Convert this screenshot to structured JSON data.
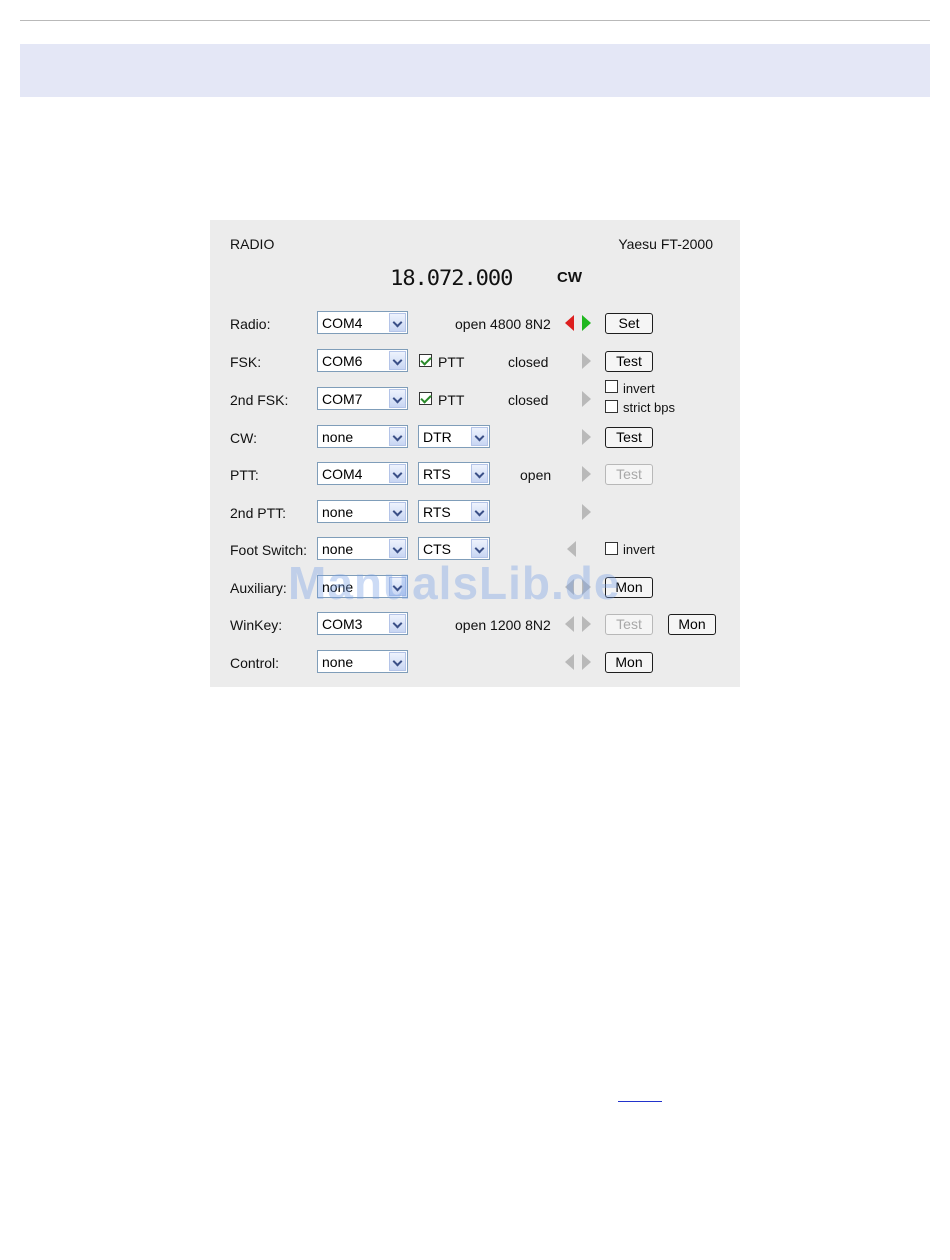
{
  "panel": {
    "title": "RADIO",
    "radio_model": "Yaesu FT-2000",
    "frequency": "18.072.000",
    "mode": "CW"
  },
  "rows": {
    "radio": {
      "label": "Radio:",
      "port": "COM4",
      "status": "open 4800 8N2",
      "button": "Set"
    },
    "fsk": {
      "label": "FSK:",
      "port": "COM6",
      "ptt_label": "PTT",
      "ptt_checked": true,
      "status": "closed",
      "button": "Test"
    },
    "fsk2": {
      "label": "2nd FSK:",
      "port": "COM7",
      "ptt_label": "PTT",
      "ptt_checked": true,
      "status": "closed",
      "invert_label": "invert",
      "strict_label": "strict bps"
    },
    "cw": {
      "label": "CW:",
      "port": "none",
      "line": "DTR",
      "button": "Test"
    },
    "ptt": {
      "label": "PTT:",
      "port": "COM4",
      "line": "RTS",
      "status": "open",
      "button": "Test"
    },
    "ptt2": {
      "label": "2nd PTT:",
      "port": "none",
      "line": "RTS"
    },
    "foot": {
      "label": "Foot Switch:",
      "port": "none",
      "line": "CTS",
      "invert_label": "invert"
    },
    "aux": {
      "label": "Auxiliary:",
      "port": "none",
      "button": "Mon"
    },
    "winkey": {
      "label": "WinKey:",
      "port": "COM3",
      "status": "open 1200 8N2",
      "test_button": "Test",
      "mon_button": "Mon"
    },
    "control": {
      "label": "Control:",
      "port": "none",
      "button": "Mon"
    }
  },
  "watermark": "ManualsLib.de",
  "colors": {
    "header_band": "#e4e7f6",
    "panel_bg": "#ececec",
    "led_red": "#dd1f1f",
    "led_green": "#1fb71f"
  }
}
